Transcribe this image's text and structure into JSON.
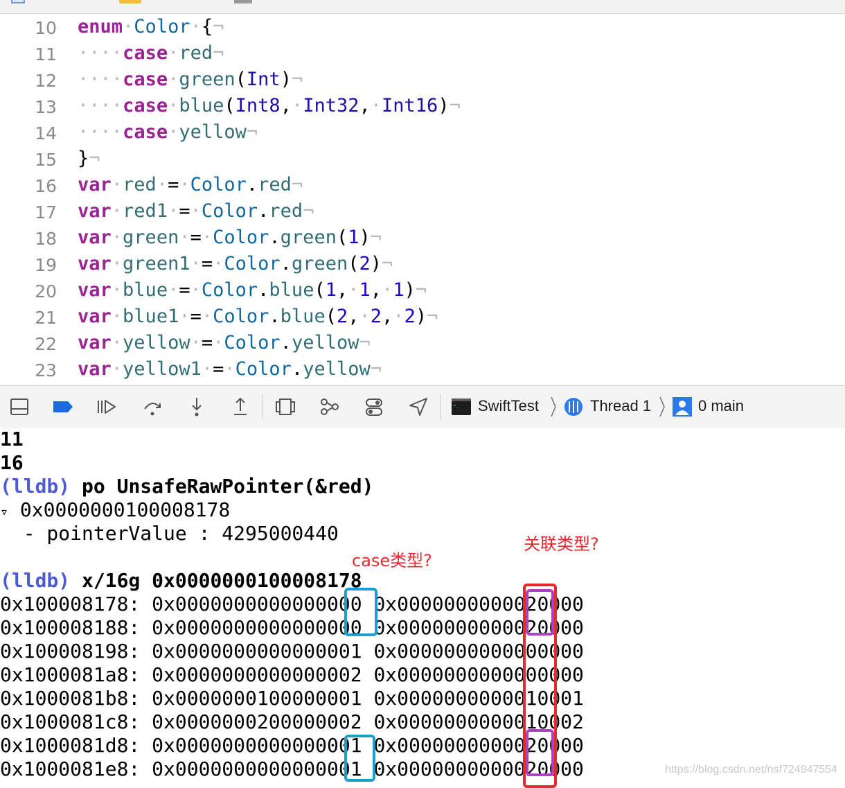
{
  "editor": {
    "lines": [
      {
        "no": "10",
        "code": "enum·Color·{¬"
      },
      {
        "no": "11",
        "code": "····case·red¬"
      },
      {
        "no": "12",
        "code": "····case·green(Int)¬"
      },
      {
        "no": "13",
        "code": "····case·blue(Int8,·Int32,·Int16)¬"
      },
      {
        "no": "14",
        "code": "····case·yellow¬"
      },
      {
        "no": "15",
        "code": "}¬"
      },
      {
        "no": "16",
        "code": "var·red·=·Color.red¬"
      },
      {
        "no": "17",
        "code": "var·red1·=·Color.red¬"
      },
      {
        "no": "18",
        "code": "var·green·=·Color.green(1)¬"
      },
      {
        "no": "19",
        "code": "var·green1·=·Color.green(2)¬"
      },
      {
        "no": "20",
        "code": "var·blue·=·Color.blue(1,·1,·1)¬"
      },
      {
        "no": "21",
        "code": "var·blue1·=·Color.blue(2,·2,·2)¬"
      },
      {
        "no": "22",
        "code": "var·yellow·=·Color.yellow¬"
      },
      {
        "no": "23",
        "code": "var·yellow1·=·Color.yellow¬"
      }
    ]
  },
  "toolbar": {
    "icons": [
      "hide-debug-area-icon",
      "breakpoints-toggle-icon",
      "continue-icon",
      "step-over-icon",
      "step-into-icon",
      "step-out-icon",
      "view-hierarchy-icon",
      "memory-graph-icon",
      "environment-overrides-icon",
      "simulate-location-icon"
    ],
    "breadcrumb": {
      "target": "SwiftTest",
      "thread": "Thread 1",
      "frame": "0 main"
    },
    "colors": {
      "breakpoint_active": "#1a6be0",
      "frame_icon": "#2b78f0"
    }
  },
  "console": {
    "output_1": "11",
    "output_2": "16",
    "prompt": "(lldb)",
    "cmd_1": "po UnsafeRawPointer(&red)",
    "disclosure": "▿",
    "pointer": "0x0000000100008178",
    "pointer_value": "  - pointerValue : 4295000440",
    "cmd_2": "x/16g 0x0000000100008178",
    "memory_rows": [
      {
        "addr": "0x100008178:",
        "w1": "0x0000000000000000",
        "w2": "0x0000000000020000"
      },
      {
        "addr": "0x100008188:",
        "w1": "0x0000000000000000",
        "w2": "0x0000000000020000"
      },
      {
        "addr": "0x100008198:",
        "w1": "0x0000000000000001",
        "w2": "0x0000000000000000"
      },
      {
        "addr": "0x1000081a8:",
        "w1": "0x0000000000000002",
        "w2": "0x0000000000000000"
      },
      {
        "addr": "0x1000081b8:",
        "w1": "0x0000000100000001",
        "w2": "0x0000000000010001"
      },
      {
        "addr": "0x1000081c8:",
        "w1": "0x0000000200000002",
        "w2": "0x0000000000010002"
      },
      {
        "addr": "0x1000081d8:",
        "w1": "0x0000000000000001",
        "w2": "0x0000000000020000"
      },
      {
        "addr": "0x1000081e8:",
        "w1": "0x0000000000000001",
        "w2": "0x0000000000020000"
      }
    ]
  },
  "annotations": {
    "case_label": "case类型?",
    "assoc_label": "关联类型?",
    "color_red": "#e8282d",
    "color_blue": "#1a9fd0",
    "color_purple": "#b040c8"
  },
  "watermark": "https://blog.csdn.net/nsf724947554"
}
